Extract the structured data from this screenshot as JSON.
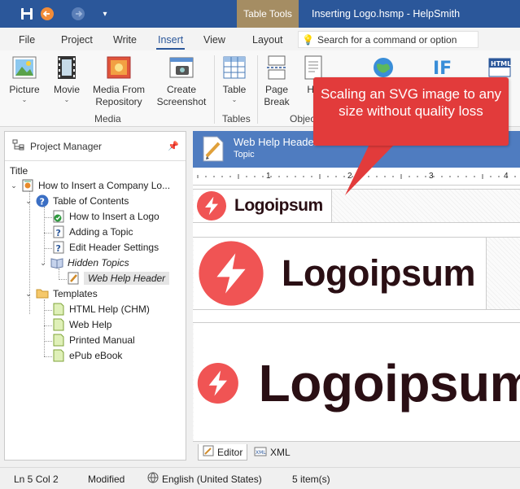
{
  "window": {
    "title": "Inserting Logo.hsmp - HelpSmith",
    "context_tab": "Table Tools"
  },
  "ribbon_tabs": [
    "File",
    "Project",
    "Write",
    "Insert",
    "View",
    "Layout"
  ],
  "search": {
    "label": "Search for a command or option"
  },
  "ribbon": {
    "buttons": [
      "Picture",
      "Movie",
      "Media From Repository",
      "Create Screenshot",
      "Table",
      "Page Break",
      "Ho"
    ],
    "groups": [
      "Media",
      "Tables",
      "Objec"
    ]
  },
  "project_manager": {
    "title": "Project Manager",
    "column": "Title",
    "tree": [
      {
        "label": "How to Insert a Company Lo...",
        "icon": "project-icon"
      },
      {
        "label": "Table of Contents",
        "icon": "help-icon"
      },
      {
        "label": "How to Insert a Logo",
        "icon": "topic-check-icon"
      },
      {
        "label": "Adding a Topic",
        "icon": "topic-question-icon"
      },
      {
        "label": "Edit Header Settings",
        "icon": "topic-question-icon"
      },
      {
        "label": "Hidden Topics",
        "icon": "hidden-book-icon"
      },
      {
        "label": "Web Help Header",
        "icon": "topic-edit-icon"
      },
      {
        "label": "Templates",
        "icon": "folder-icon"
      },
      {
        "label": "HTML Help (CHM)",
        "icon": "template-icon"
      },
      {
        "label": "Web Help",
        "icon": "template-icon"
      },
      {
        "label": "Printed Manual",
        "icon": "template-icon"
      },
      {
        "label": "ePub eBook",
        "icon": "template-icon"
      }
    ]
  },
  "editor": {
    "title": "Web Help Header",
    "subtitle": "Topic",
    "ruler_marks": [
      "1",
      "2",
      "3",
      "4"
    ],
    "logo_text": "Logoipsum",
    "tabs": [
      "Editor",
      "XML"
    ]
  },
  "callout": {
    "text": "Scaling an SVG image to any size without quality loss",
    "color": "#e23b3b"
  },
  "status": {
    "position": "Ln 5 Col 2",
    "modified": "Modified",
    "language": "English (United States)",
    "items": "5 item(s)"
  },
  "colors": {
    "accent": "#2b579a",
    "header": "#4f7cc0",
    "logo": "#f05454",
    "context": "#a58d63"
  }
}
